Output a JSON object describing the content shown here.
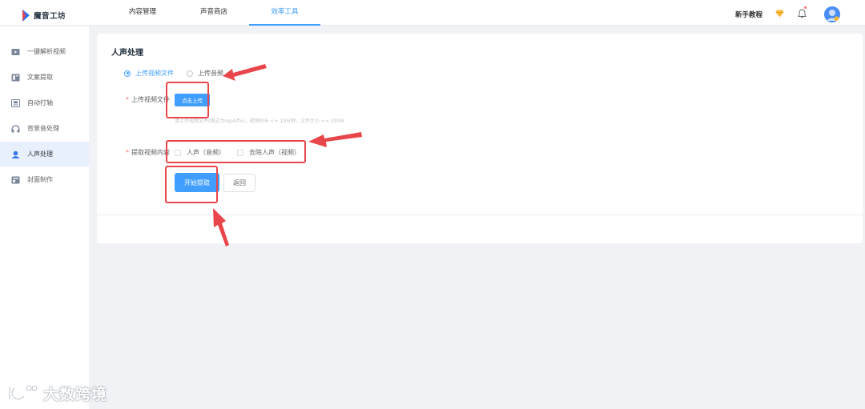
{
  "app": {
    "logo_text": "魔音工坊"
  },
  "topnav": {
    "tabs": [
      {
        "label": "内容管理"
      },
      {
        "label": "声音商店"
      },
      {
        "label": "效率工具"
      }
    ],
    "active_tab": "效率工具",
    "help_label": "新手教程",
    "icons": [
      "diamond-icon",
      "bell-icon",
      "avatar"
    ],
    "accent_color": "#409eff"
  },
  "sidebar": {
    "items": [
      {
        "label": "一键解析视频",
        "icon": "video-parse-icon"
      },
      {
        "label": "文案提取",
        "icon": "text-extract-icon"
      },
      {
        "label": "自动打轴",
        "icon": "auto-subtitle-icon"
      },
      {
        "label": "背景音处理",
        "icon": "background-audio-icon"
      },
      {
        "label": "人声处理",
        "icon": "vocal-icon"
      },
      {
        "label": "封面制作",
        "icon": "cover-icon"
      }
    ],
    "active_item": "人声处理"
  },
  "main": {
    "title": "人声处理",
    "upload_type": {
      "options": [
        {
          "label": "上传视频文件",
          "checked": true
        },
        {
          "label": "上传音频"
        }
      ]
    },
    "upload": {
      "label": "上传视频文件",
      "button_label": "点击上传",
      "hint": "请上传视频文件(格式为mp4/flv)，视频时长 <= 10分钟，文件大小 <= 200M"
    },
    "extract": {
      "label": "提取视频内容",
      "options": [
        {
          "label": "人声（音频）",
          "checked": false
        },
        {
          "label": "去除人声（视频）",
          "checked": false
        }
      ]
    },
    "actions": {
      "start_label": "开始提取",
      "back_label": "返回"
    }
  },
  "annotations": {
    "color": "#e8464a"
  },
  "watermark": {
    "text": "大数跨境"
  }
}
